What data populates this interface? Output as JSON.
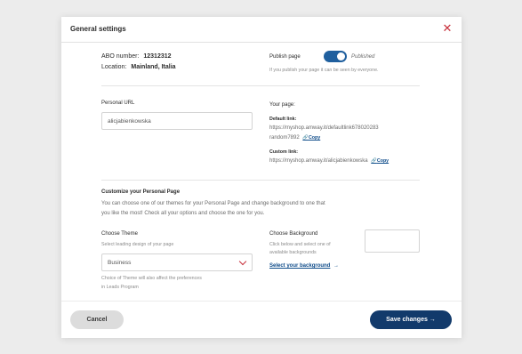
{
  "modal": {
    "title": "General settings",
    "close_glyph": "✕"
  },
  "abo": {
    "label": "ABO number:",
    "value": "12312312",
    "location_label": "Location:",
    "location_value": "Mainland, Italia"
  },
  "publish": {
    "label": "Publish page",
    "status": "Published",
    "checked": true,
    "help": "If you publish your page it can be seen by everyone."
  },
  "personal_url": {
    "label": "Personal URL",
    "value": "alicjabienkowska"
  },
  "your_page": {
    "label": "Your page:",
    "default_label": "Default link:",
    "default_line1": "https://myshop.amway.it/defaultlink678020283",
    "default_line2": "random7892",
    "custom_label": "Custom link:",
    "custom_value": "https://myshop.amway.it/alicjabienkowska",
    "copy_label": "Copy",
    "copy_icon": "🔗"
  },
  "customize": {
    "title": "Customize your Personal Page",
    "desc_line1": "You can choose one of our themes for your Personal Page and change background to one that",
    "desc_line2": "you like the most! Check all your options and choose the one for you."
  },
  "theme": {
    "label": "Choose Theme",
    "help": "Select leading design of your page",
    "selected": "Business",
    "note_line1": "Choice of Theme will also affect the preferences",
    "note_line2": "in Leads Program"
  },
  "background": {
    "label": "Choose Background",
    "help_line1": "Click below and select one of",
    "help_line2": "available backgrounds",
    "link": "Select your background",
    "arrow": "→"
  },
  "footer": {
    "cancel": "Cancel",
    "save": "Save changes →"
  },
  "colors": {
    "accent": "#123a6b",
    "link": "#0f4c8a",
    "close": "#c8323d"
  }
}
